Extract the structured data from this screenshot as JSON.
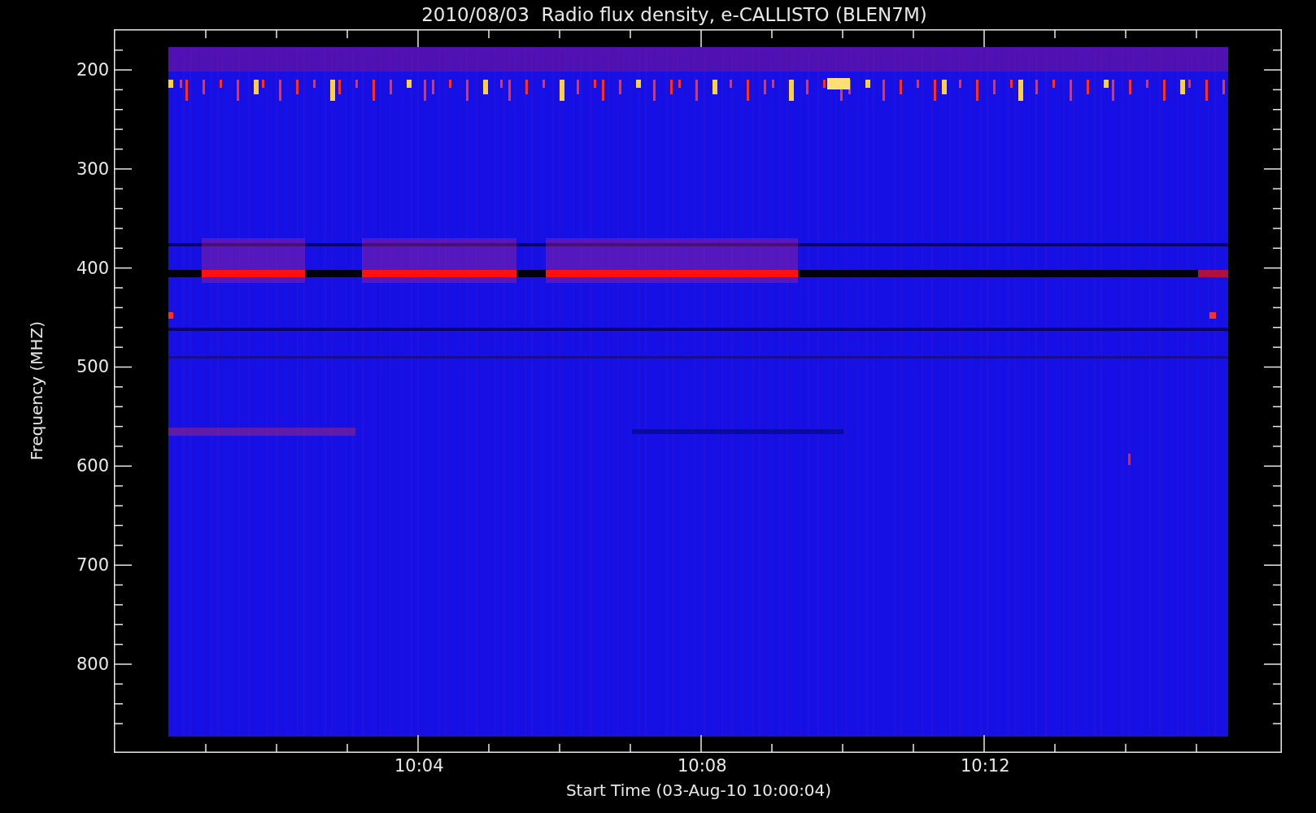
{
  "chart": {
    "title": "2010/08/03  Radio flux density, e-CALLISTO (BLEN7M)",
    "ylabel": "Frequency (MHZ)",
    "xlabel": "Start Time (03-Aug-10 10:00:04)",
    "yticks": [
      "200",
      "300",
      "400",
      "500",
      "600",
      "700",
      "800"
    ],
    "xticks": [
      "10:04",
      "10:08",
      "10:12"
    ]
  }
}
